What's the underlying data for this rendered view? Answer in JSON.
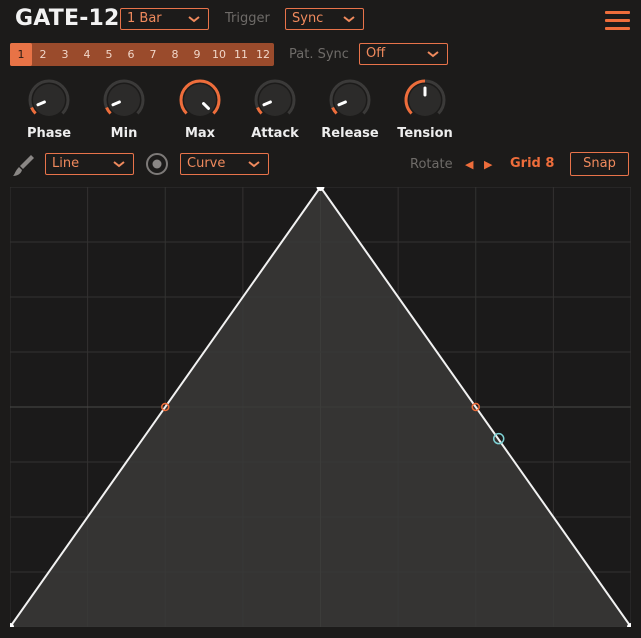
{
  "header": {
    "title": "GATE-12",
    "length": "1 Bar",
    "trigger_label": "Trigger",
    "trigger_value": "Sync",
    "menu_icon": "hamburger-menu-icon"
  },
  "patterns": {
    "items": [
      "1",
      "2",
      "3",
      "4",
      "5",
      "6",
      "7",
      "8",
      "9",
      "10",
      "11",
      "12"
    ],
    "active": "1",
    "pat_sync_label": "Pat. Sync",
    "pat_sync_value": "Off"
  },
  "knobs": [
    {
      "label": "Phase",
      "value": 0.08
    },
    {
      "label": "Min",
      "value": 0.08
    },
    {
      "label": "Max",
      "value": 1.0
    },
    {
      "label": "Attack",
      "value": 0.08
    },
    {
      "label": "Release",
      "value": 0.08
    },
    {
      "label": "Tension",
      "value": 0.5
    }
  ],
  "toolbar": {
    "brush_icon": "paintbrush-icon",
    "shape": "Line",
    "point_icon": "point-mode-icon",
    "point_mode": "Curve",
    "rotate_label": "Rotate",
    "rotate_left_icon": "triangle-left-icon",
    "rotate_right_icon": "triangle-right-icon",
    "grid_label": "Grid 8",
    "snap_label": "Snap"
  },
  "envelope": {
    "grid_divisions": 8,
    "points": [
      [
        0,
        0
      ],
      [
        0.5,
        1
      ],
      [
        1,
        0
      ]
    ],
    "curve_handles": [
      [
        0.25,
        0.5
      ],
      [
        0.75,
        0.5
      ]
    ],
    "playhead_marker": [
      0.787,
      0.428
    ]
  },
  "colors": {
    "accent": "#ee6d3b",
    "pattern_bar": "#9a4b2c",
    "fill": "#3a3938",
    "line": "#f2f2f2",
    "playhead": "#7fd3d6"
  }
}
